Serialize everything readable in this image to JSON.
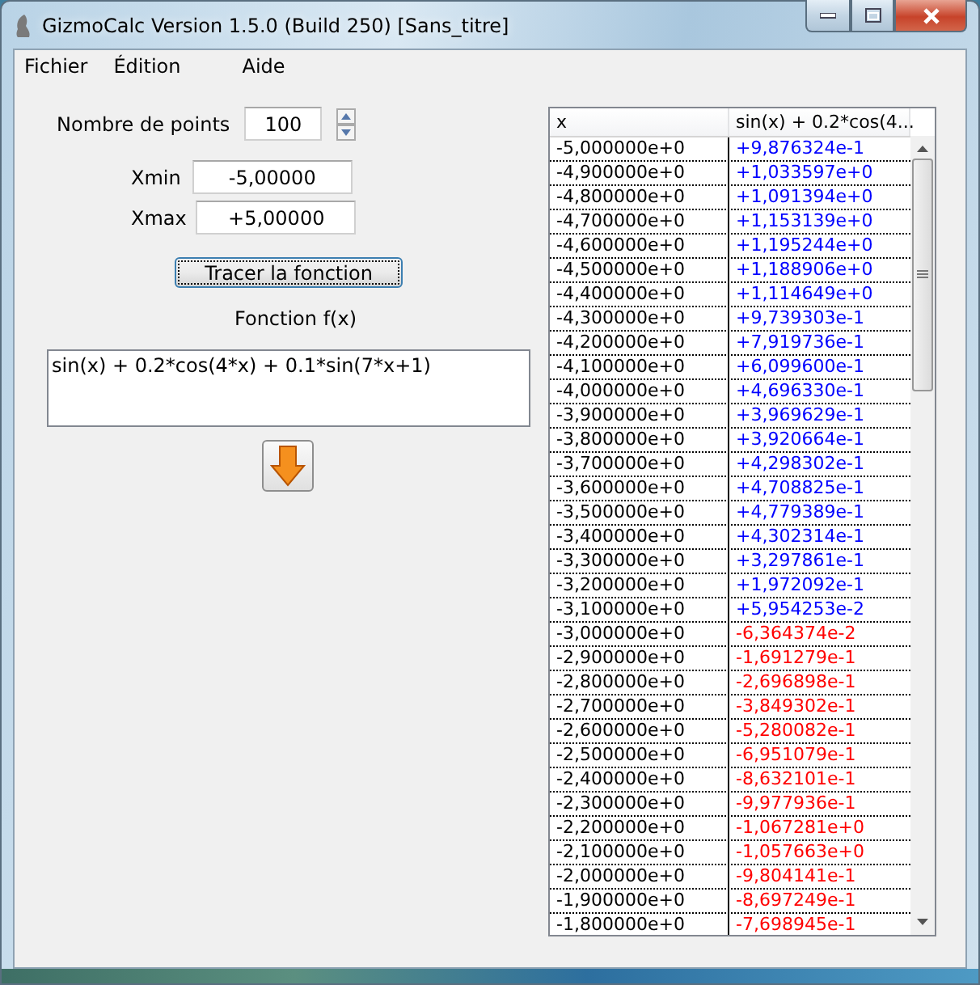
{
  "window": {
    "title": "GizmoCalc  Version 1.5.0 (Build 250) [Sans_titre]"
  },
  "menu": [
    "Fichier",
    "Édition",
    "Aide"
  ],
  "form": {
    "points_label": "Nombre de points",
    "points": "100",
    "xmin_label": "Xmin",
    "xmin": "-5,00000",
    "xmax_label": "Xmax",
    "xmax": "+5,00000",
    "plot_button": "Tracer la fonction",
    "function_label": "Fonction f(x)",
    "function": "sin(x) + 0.2*cos(4*x) + 0.1*sin(7*x+1)"
  },
  "table": {
    "columns": [
      "x",
      "sin(x) + 0.2*cos(4..."
    ],
    "rows": [
      {
        "x": "-5,000000e+0",
        "value": "+9,876324e-1",
        "color": "#0000ff"
      },
      {
        "x": "-4,900000e+0",
        "value": "+1,033597e+0",
        "color": "#0000ff"
      },
      {
        "x": "-4,800000e+0",
        "value": "+1,091394e+0",
        "color": "#0000ff"
      },
      {
        "x": "-4,700000e+0",
        "value": "+1,153139e+0",
        "color": "#0000ff"
      },
      {
        "x": "-4,600000e+0",
        "value": "+1,195244e+0",
        "color": "#0000ff"
      },
      {
        "x": "-4,500000e+0",
        "value": "+1,188906e+0",
        "color": "#0000ff"
      },
      {
        "x": "-4,400000e+0",
        "value": "+1,114649e+0",
        "color": "#0000ff"
      },
      {
        "x": "-4,300000e+0",
        "value": "+9,739303e-1",
        "color": "#0000ff"
      },
      {
        "x": "-4,200000e+0",
        "value": "+7,919736e-1",
        "color": "#0000ff"
      },
      {
        "x": "-4,100000e+0",
        "value": "+6,099600e-1",
        "color": "#0000ff"
      },
      {
        "x": "-4,000000e+0",
        "value": "+4,696330e-1",
        "color": "#0000ff"
      },
      {
        "x": "-3,900000e+0",
        "value": "+3,969629e-1",
        "color": "#0000ff"
      },
      {
        "x": "-3,800000e+0",
        "value": "+3,920664e-1",
        "color": "#0000ff"
      },
      {
        "x": "-3,700000e+0",
        "value": "+4,298302e-1",
        "color": "#0000ff"
      },
      {
        "x": "-3,600000e+0",
        "value": "+4,708825e-1",
        "color": "#0000ff"
      },
      {
        "x": "-3,500000e+0",
        "value": "+4,779389e-1",
        "color": "#0000ff"
      },
      {
        "x": "-3,400000e+0",
        "value": "+4,302314e-1",
        "color": "#0000ff"
      },
      {
        "x": "-3,300000e+0",
        "value": "+3,297861e-1",
        "color": "#0000ff"
      },
      {
        "x": "-3,200000e+0",
        "value": "+1,972092e-1",
        "color": "#0000ff"
      },
      {
        "x": "-3,100000e+0",
        "value": "+5,954253e-2",
        "color": "#0000ff"
      },
      {
        "x": "-3,000000e+0",
        "value": "-6,364374e-2",
        "color": "#ff0000"
      },
      {
        "x": "-2,900000e+0",
        "value": "-1,691279e-1",
        "color": "#ff0000"
      },
      {
        "x": "-2,800000e+0",
        "value": "-2,696898e-1",
        "color": "#ff0000"
      },
      {
        "x": "-2,700000e+0",
        "value": "-3,849302e-1",
        "color": "#ff0000"
      },
      {
        "x": "-2,600000e+0",
        "value": "-5,280082e-1",
        "color": "#ff0000"
      },
      {
        "x": "-2,500000e+0",
        "value": "-6,951079e-1",
        "color": "#ff0000"
      },
      {
        "x": "-2,400000e+0",
        "value": "-8,632101e-1",
        "color": "#ff0000"
      },
      {
        "x": "-2,300000e+0",
        "value": "-9,977936e-1",
        "color": "#ff0000"
      },
      {
        "x": "-2,200000e+0",
        "value": "-1,067281e+0",
        "color": "#ff0000"
      },
      {
        "x": "-2,100000e+0",
        "value": "-1,057663e+0",
        "color": "#ff0000"
      },
      {
        "x": "-2,000000e+0",
        "value": "-9,804141e-1",
        "color": "#ff0000"
      },
      {
        "x": "-1,900000e+0",
        "value": "-8,697249e-1",
        "color": "#ff0000"
      },
      {
        "x": "-1,800000e+0",
        "value": "-7,698945e-1",
        "color": "#ff0000"
      }
    ]
  }
}
